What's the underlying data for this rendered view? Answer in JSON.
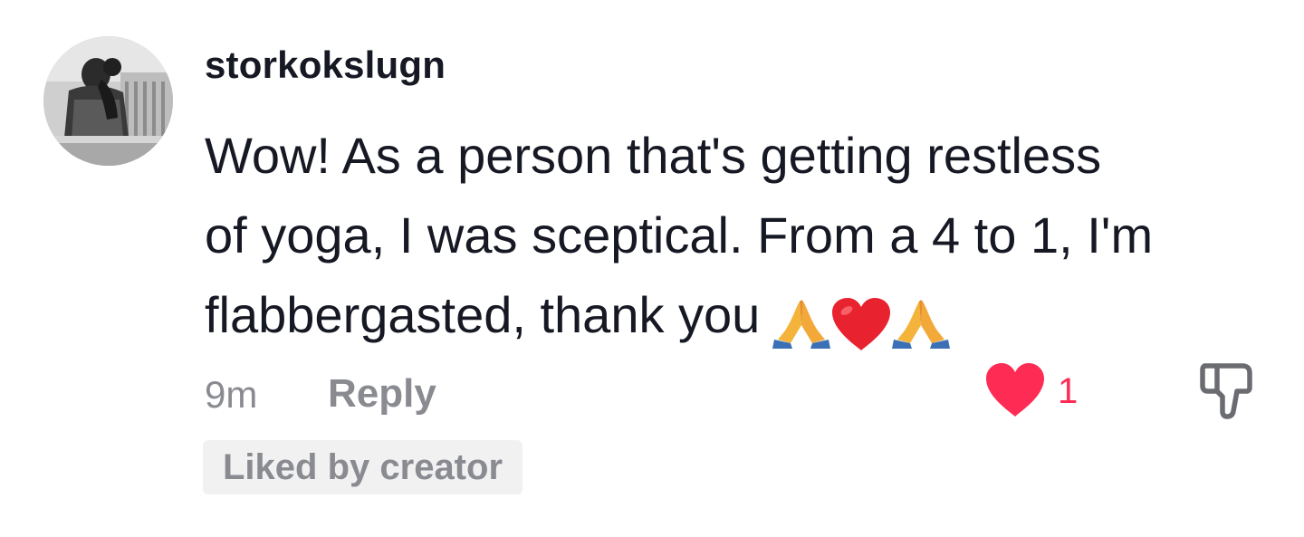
{
  "comment": {
    "username": "storkokslugn",
    "text_lines": [
      "Wow! As a person that's getting restless",
      "of yoga, I was sceptical. From a 4 to 1, I'm",
      "flabbergasted, thank you"
    ],
    "emojis": [
      "pray-emoji",
      "red-heart-emoji",
      "pray-emoji"
    ],
    "timestamp": "9m",
    "reply_label": "Reply",
    "like_count": "1",
    "liked": true,
    "liked_by_creator_label": "Liked by creator"
  },
  "colors": {
    "text_primary": "#161823",
    "text_secondary": "#8a8b91",
    "like_red": "#fe2c55",
    "badge_bg": "#f1f1f2"
  },
  "icons": {
    "like": "heart-filled-icon",
    "dislike": "thumbs-down-icon"
  }
}
